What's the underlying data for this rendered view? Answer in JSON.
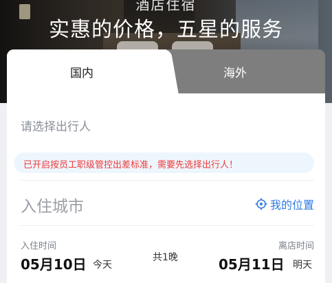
{
  "hero": {
    "subtitle": "酒店住宿",
    "title": "实惠的价格，五星的服务"
  },
  "tabs": {
    "domestic": "国内",
    "overseas": "海外"
  },
  "traveler": {
    "placeholder": "请选择出行人"
  },
  "notice": {
    "text": "已开启按员工职级管控出差标准，需要先选择出行人！"
  },
  "city": {
    "placeholder": "入住城市",
    "my_location": "我的位置",
    "location_icon": "crosshair-location-icon"
  },
  "dates": {
    "checkin_label": "入住时间",
    "checkin_date": "05月10日",
    "checkin_day": "今天",
    "nights": "共1晚",
    "checkout_label": "离店时间",
    "checkout_date": "05月11日",
    "checkout_day": "明天"
  },
  "colors": {
    "accent_blue": "#2f7be3",
    "notice_red": "#ef3b3b",
    "notice_bg": "#eef6fd"
  }
}
